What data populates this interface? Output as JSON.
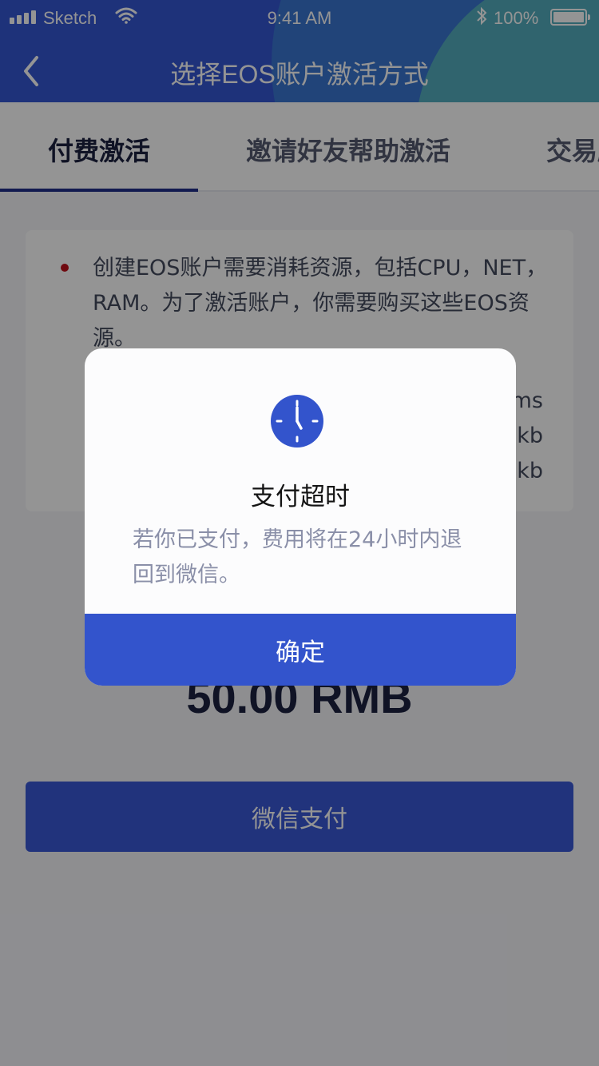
{
  "status_bar": {
    "carrier": "Sketch",
    "time": "9:41 AM",
    "battery": "100%"
  },
  "nav": {
    "title": "选择EOS账户激活方式"
  },
  "tabs": [
    {
      "label": "付费激活",
      "active": true
    },
    {
      "label": "邀请好友帮助激活",
      "active": false
    },
    {
      "label": "交易所",
      "active": false
    }
  ],
  "info": {
    "text": "创建EOS账户需要消耗资源，包括CPU，NET，RAM。为了激活账户，你需要购买这些EOS资源。",
    "units": [
      "ms",
      "kb",
      "kb"
    ]
  },
  "amount": "50.00 RMB",
  "pay_button": "微信支付",
  "dialog": {
    "icon": "clock-icon",
    "title": "支付超时",
    "message": "若你已支付，费用将在24小时内退回到微信。",
    "confirm": "确定"
  },
  "colors": {
    "accent": "#3354cc",
    "header": "#3457d3",
    "bullet": "#c0101a"
  }
}
